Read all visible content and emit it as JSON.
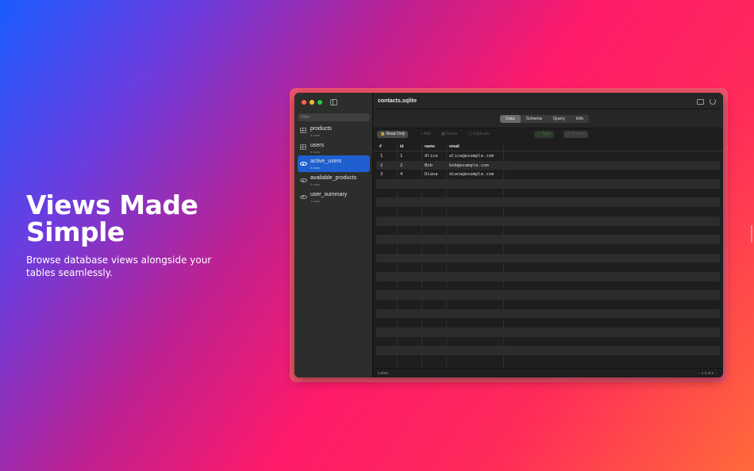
{
  "hero": {
    "headline": "Views Made Simple",
    "subline": "Browse database views alongside your tables seamlessly."
  },
  "window": {
    "title": "contacts.sqlite",
    "filter_placeholder": "Filter"
  },
  "sidebar": {
    "items": [
      {
        "name": "products",
        "sub": "5 rows",
        "icon": "table-icon"
      },
      {
        "name": "users",
        "sub": "5 rows",
        "icon": "table-icon"
      },
      {
        "name": "active_users",
        "sub": "3 rows",
        "icon": "eye-icon",
        "active": true
      },
      {
        "name": "available_products",
        "sub": "3 rows",
        "icon": "eye-icon"
      },
      {
        "name": "user_summary",
        "sub": "1 rows",
        "icon": "eye-icon"
      }
    ]
  },
  "tabs": [
    "Data",
    "Schema",
    "Query",
    "Info"
  ],
  "active_tab": "Data",
  "toolbar": {
    "read_only": "Read Only",
    "add": "Add",
    "delete": "Delete",
    "duplicate": "Duplicate",
    "save": "Save",
    "discard": "Discard"
  },
  "grid": {
    "columns": [
      "#",
      "id",
      "name",
      "email"
    ],
    "rows": [
      [
        "1",
        "1",
        "Alice",
        "alice@example.com"
      ],
      [
        "2",
        "2",
        "Bob",
        "bob@example.com"
      ],
      [
        "3",
        "4",
        "Diana",
        "diana@example.com"
      ]
    ]
  },
  "status": {
    "time": "0.000s",
    "pager": "1-3 of 3"
  },
  "colors": {
    "accent": "#1f5fcf",
    "frame": "#f0556e"
  }
}
